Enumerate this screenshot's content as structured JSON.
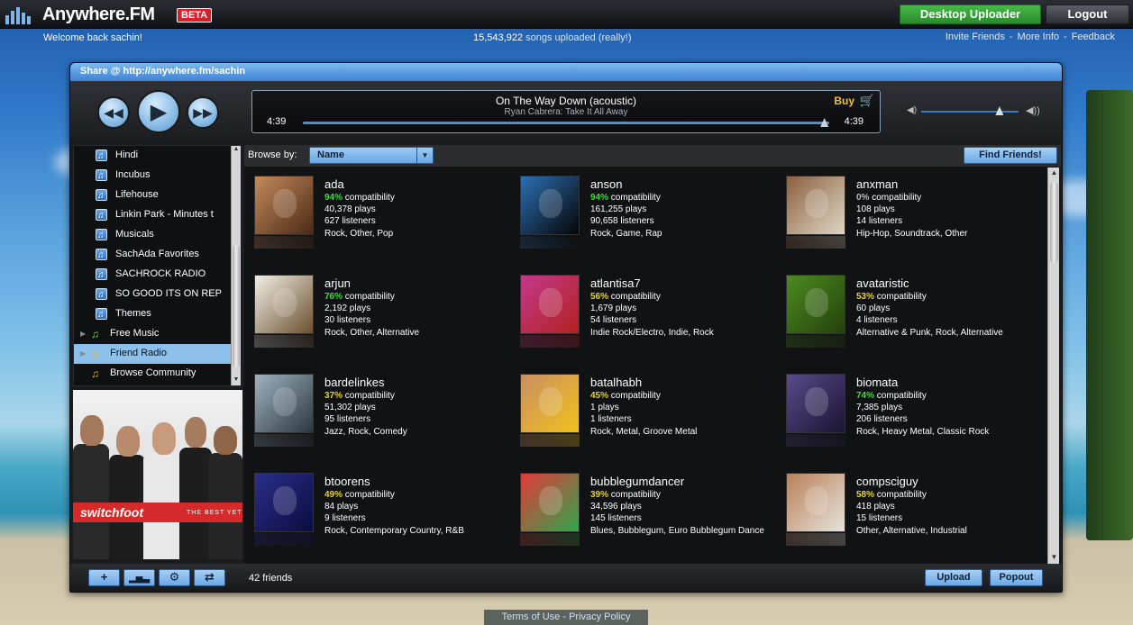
{
  "app": {
    "name": "Anywhere.FM",
    "beta_label": "BETA"
  },
  "topbar": {
    "desktop_uploader": "Desktop Uploader",
    "logout": "Logout"
  },
  "infobar": {
    "welcome": "Welcome back sachin!",
    "songs_count": "15,543,922",
    "songs_suffix": "songs uploaded (really!)",
    "links": [
      "Invite Friends",
      "More Info",
      "Feedback"
    ],
    "link_separator": "-"
  },
  "share_url": "Share @ http://anywhere.fm/sachin",
  "player": {
    "song_title": "On The Way Down (acoustic)",
    "song_artist_album": "Ryan Cabrera: Take It All Away",
    "buy_label": "Buy",
    "elapsed": "4:39",
    "duration": "4:39",
    "progress_fraction": 0.99,
    "volume_fraction": 0.8
  },
  "sidebar": {
    "items": [
      {
        "label": "Hindi",
        "kind": "playlist"
      },
      {
        "label": "Incubus",
        "kind": "playlist"
      },
      {
        "label": "Lifehouse",
        "kind": "playlist"
      },
      {
        "label": "Linkin Park - Minutes t",
        "kind": "playlist"
      },
      {
        "label": "Musicals",
        "kind": "playlist"
      },
      {
        "label": "SachAda Favorites",
        "kind": "playlist"
      },
      {
        "label": "SACHROCK RADIO",
        "kind": "playlist"
      },
      {
        "label": "SO GOOD ITS ON REP",
        "kind": "playlist"
      },
      {
        "label": "Themes",
        "kind": "playlist"
      },
      {
        "label": "Free Music",
        "kind": "category"
      },
      {
        "label": "Friend Radio",
        "kind": "category",
        "active": true
      },
      {
        "label": "Browse Community",
        "kind": "category"
      }
    ]
  },
  "album_art": {
    "band": "switchfoot",
    "subtitle": "THE BEST YET"
  },
  "browse": {
    "label": "Browse by:",
    "selected": "Name",
    "find_friends": "Find Friends!"
  },
  "friends": [
    {
      "name": "ada",
      "compat": "94%",
      "compat_color": "#3fdc3f",
      "plays": "40,378 plays",
      "listeners": "627 listeners",
      "genres": "Rock, Other, Pop",
      "avatar_colors": [
        "#c48a5c",
        "#4b2a17"
      ]
    },
    {
      "name": "anson",
      "compat": "94%",
      "compat_color": "#3fdc3f",
      "plays": "161,255 plays",
      "listeners": "90,658 listeners",
      "genres": "Rock, Game, Rap",
      "avatar_colors": [
        "#2d6fb3",
        "#050505"
      ]
    },
    {
      "name": "anxman",
      "compat": "0%",
      "compat_color": "#b9b9b9",
      "plays": "108 plays",
      "listeners": "14 listeners",
      "genres": "Hip-Hop, Soundtrack, Other",
      "avatar_colors": [
        "#8a6040",
        "#e0d6c4"
      ]
    },
    {
      "name": "arjun",
      "compat": "76%",
      "compat_color": "#3fdc3f",
      "plays": "2,192 plays",
      "listeners": "30 listeners",
      "genres": "Rock, Other, Alternative",
      "avatar_colors": [
        "#f2efe6",
        "#6b4f2e"
      ]
    },
    {
      "name": "atlantisa7",
      "compat": "56%",
      "compat_color": "#e2d23a",
      "plays": "1,679 plays",
      "listeners": "54 listeners",
      "genres": "Indie Rock/Electro, Indie, Rock",
      "avatar_colors": [
        "#c23a8a",
        "#b32020"
      ]
    },
    {
      "name": "avataristic",
      "compat": "53%",
      "compat_color": "#e2d23a",
      "plays": "60 plays",
      "listeners": "4 listeners",
      "genres": "Alternative & Punk, Rock, Alternative",
      "avatar_colors": [
        "#4d8a1f",
        "#23410d"
      ]
    },
    {
      "name": "bardelinkes",
      "compat": "37%",
      "compat_color": "#e2d23a",
      "plays": "51,302 plays",
      "listeners": "95 listeners",
      "genres": "Jazz, Rock, Comedy",
      "avatar_colors": [
        "#9fb4c0",
        "#2c3640"
      ]
    },
    {
      "name": "batalhabh",
      "compat": "45%",
      "compat_color": "#e2d23a",
      "plays": "1 plays",
      "listeners": "1 listeners",
      "genres": "Rock, Metal, Groove Metal",
      "avatar_colors": [
        "#c98e63",
        "#f0c21a"
      ]
    },
    {
      "name": "biomata",
      "compat": "74%",
      "compat_color": "#3fdc3f",
      "plays": "7,385 plays",
      "listeners": "206 listeners",
      "genres": "Rock, Heavy Metal, Classic Rock",
      "avatar_colors": [
        "#5a4a8a",
        "#1b1433"
      ]
    },
    {
      "name": "btoorens",
      "compat": "49%",
      "compat_color": "#e2d23a",
      "plays": "84 plays",
      "listeners": "9 listeners",
      "genres": "Rock, Contemporary Country, R&B",
      "avatar_colors": [
        "#2a2f8a",
        "#0c0c40"
      ]
    },
    {
      "name": "bubblegumdancer",
      "compat": "39%",
      "compat_color": "#e2d23a",
      "plays": "34,596 plays",
      "listeners": "145 listeners",
      "genres": "Blues, Bubblegum, Euro Bubblegum Dance",
      "avatar_colors": [
        "#e23a3a",
        "#2fa64a"
      ]
    },
    {
      "name": "compsciguy",
      "compat": "58%",
      "compat_color": "#e2d23a",
      "plays": "418 plays",
      "listeners": "15 listeners",
      "genres": "Other, Alternative, Industrial",
      "avatar_colors": [
        "#b9815a",
        "#e6e2da"
      ]
    }
  ],
  "compat_label": "compatibility",
  "footer": {
    "friends_count": "42 friends",
    "upload": "Upload",
    "popout": "Popout"
  },
  "bottom_links": {
    "terms": "Terms of Use",
    "privacy": "Privacy Policy",
    "sep": "-"
  },
  "colors": {
    "accent": "#6aa8e6",
    "header": "#3d82d6",
    "green_button": "#2a8a2c"
  }
}
